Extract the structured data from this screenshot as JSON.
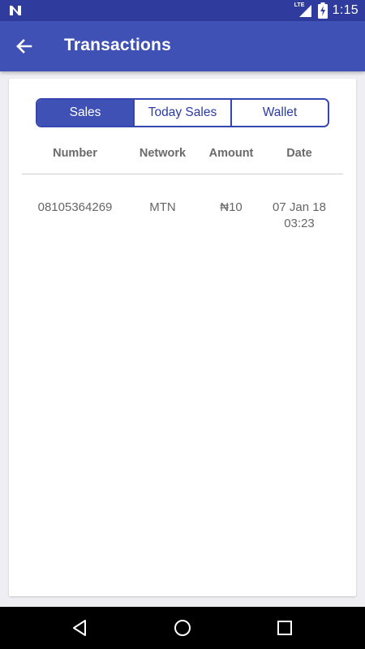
{
  "status_bar": {
    "time": "1:15",
    "network_label": "LTE",
    "icons": [
      "notification-n-icon",
      "signal-icon",
      "battery-charging-icon"
    ]
  },
  "app_bar": {
    "title": "Transactions",
    "back_icon": "arrow-back-icon",
    "background": "#3f51b5"
  },
  "tabs": [
    {
      "label": "Sales",
      "selected": true
    },
    {
      "label": "Today Sales",
      "selected": false
    },
    {
      "label": "Wallet",
      "selected": false
    }
  ],
  "table": {
    "headers": [
      "Number",
      "Network",
      "Amount",
      "Date"
    ],
    "rows": [
      {
        "number": "08105364269",
        "network": "MTN",
        "amount": "₦10",
        "date_line1": "07 Jan 18",
        "date_line2": "03:23"
      }
    ]
  },
  "nav_bar": {
    "buttons": [
      "back-triangle-icon",
      "home-circle-icon",
      "recents-square-icon"
    ]
  },
  "colors": {
    "status_bar": "#2f3c9e",
    "accent": "#3f51b5",
    "page_bg": "#eeeef3"
  }
}
